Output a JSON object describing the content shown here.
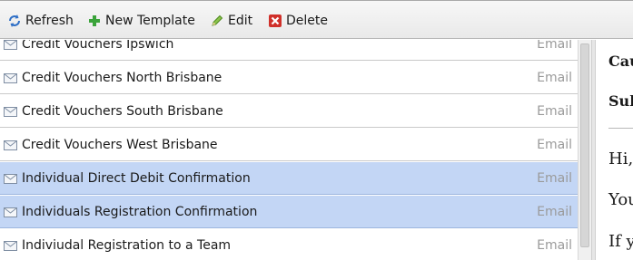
{
  "toolbar": {
    "refresh_label": "Refresh",
    "new_template_label": "New Template",
    "edit_label": "Edit",
    "delete_label": "Delete"
  },
  "templates": [
    {
      "name": "Credit Vouchers Ipswich",
      "type": "Email",
      "selected": false
    },
    {
      "name": "Credit Vouchers North Brisbane",
      "type": "Email",
      "selected": false
    },
    {
      "name": "Credit Vouchers South Brisbane",
      "type": "Email",
      "selected": false
    },
    {
      "name": "Credit Vouchers West Brisbane",
      "type": "Email",
      "selected": false
    },
    {
      "name": "Individual Direct Debit Confirmation",
      "type": "Email",
      "selected": true
    },
    {
      "name": "Individuals Registration Confirmation",
      "type": "Email",
      "selected": true
    },
    {
      "name": "Indiviudal Registration to a Team",
      "type": "Email",
      "selected": false
    }
  ],
  "preview": {
    "field1": "Cau",
    "field2": "Sul",
    "line1": "Hi,",
    "line2": "You",
    "line3": "If y"
  },
  "colors": {
    "selected_row": "#c3d6f5",
    "type_text": "#9a9a9a",
    "delete_icon": "#d0302a",
    "new_icon": "#3aa33a"
  }
}
